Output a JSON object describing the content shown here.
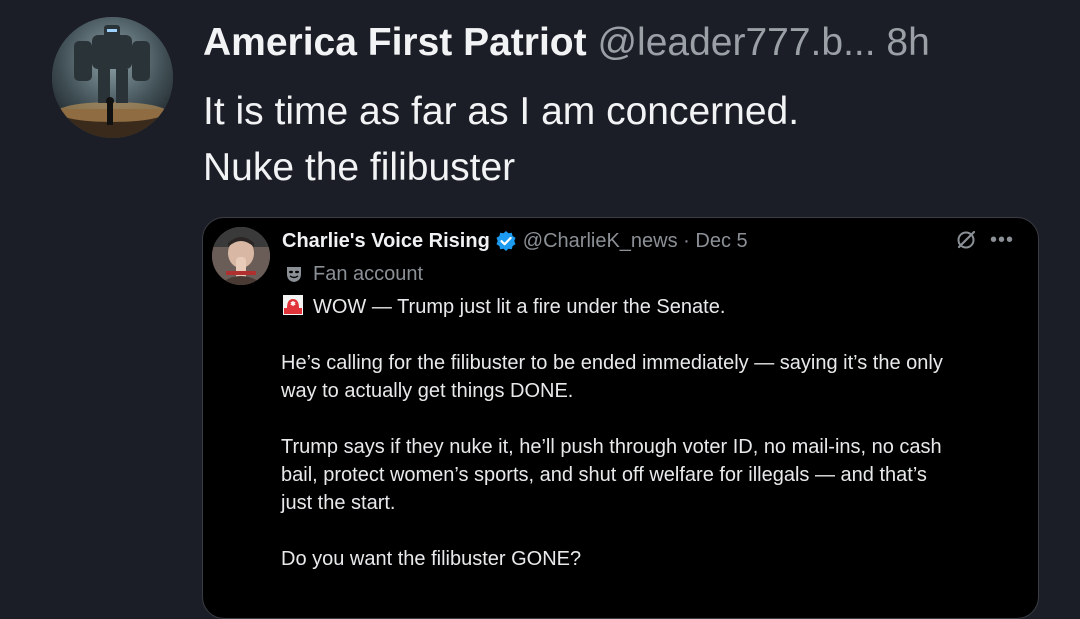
{
  "post": {
    "author_name": "America First Patriot",
    "author_handle": "@leader777.b...",
    "time": "8h",
    "text_lines": [
      "It is time as far as I am concerned.",
      "Nuke the filibuster"
    ],
    "avatar": "robot-mech-avatar-icon"
  },
  "quote": {
    "author_name": "Charlie's Voice Rising",
    "handle_date": "@CharlieK_news · Dec 5",
    "label": "Fan account",
    "icons": [
      "verified-badge-icon",
      "grok-icon",
      "more-options-icon",
      "fan-mask-icon",
      "siren-icon"
    ],
    "accent_color": "#1d9bf0",
    "body": {
      "line1": "WOW — Trump just lit a fire under the Senate.",
      "line2a": "He’s calling for the filibuster to be ended immediately — saying it’s the only",
      "line2b": "way to actually get things DONE.",
      "line3a": "Trump says if they nuke it, he’ll push through voter ID, no mail-ins, no cash",
      "line3b": "bail, protect women’s sports, and shut off welfare for illegals — and that’s",
      "line3c": "just the start.",
      "line4": "Do you want the filibuster GONE?"
    }
  }
}
